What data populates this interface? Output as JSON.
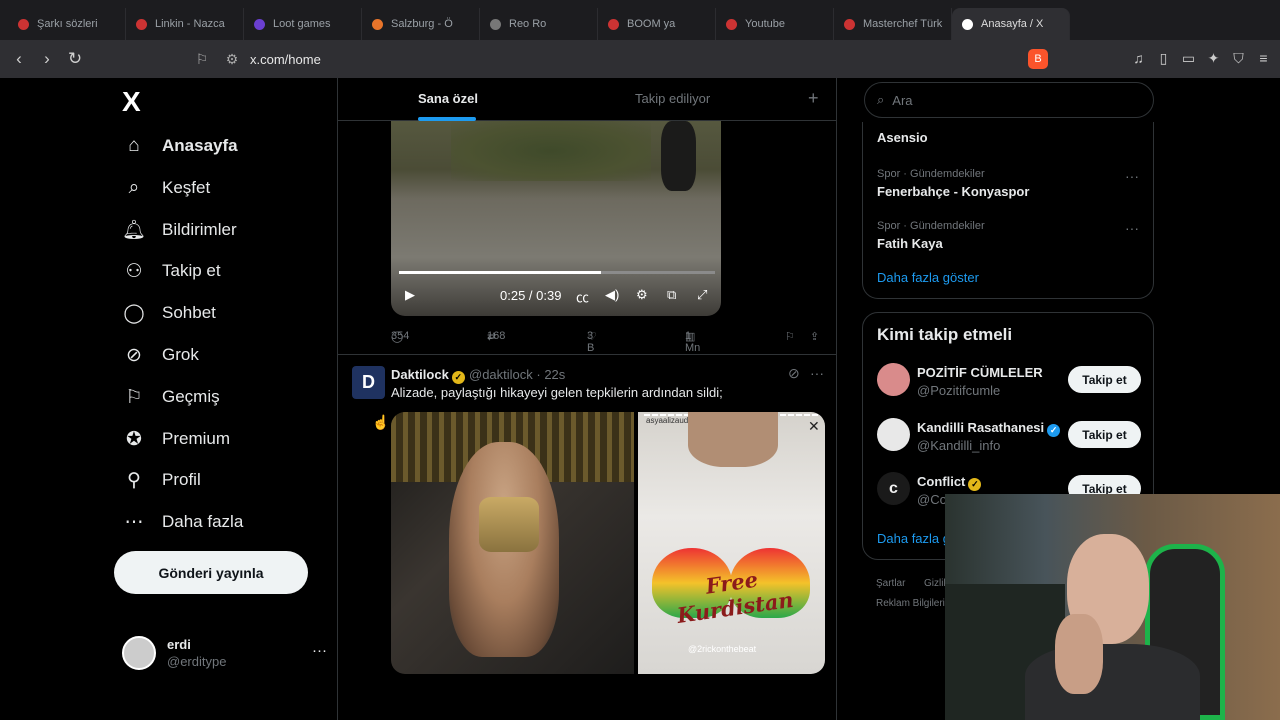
{
  "browser": {
    "tabs": [
      {
        "label": "Şarkı sözleri"
      },
      {
        "label": "Linkin - Nazca"
      },
      {
        "label": "Loot games"
      },
      {
        "label": "Salzburg - Ö"
      },
      {
        "label": "Reo Ro"
      },
      {
        "label": "BOOM ya"
      },
      {
        "label": "Youtube"
      },
      {
        "label": "Masterchef Türk"
      },
      {
        "label": "Anasayfa / X"
      }
    ],
    "url": "x.com/home"
  },
  "leftnav": {
    "logo": "X",
    "items": [
      {
        "label": "Anasayfa",
        "icon": "home-icon",
        "glyph": "⌂"
      },
      {
        "label": "Keşfet",
        "icon": "search-icon",
        "glyph": "⌕"
      },
      {
        "label": "Bildirimler",
        "icon": "bell-icon",
        "glyph": "🔔︎"
      },
      {
        "label": "Takip et",
        "icon": "add-person-icon",
        "glyph": "⚇"
      },
      {
        "label": "Sohbet",
        "icon": "chat-icon",
        "glyph": "◯"
      },
      {
        "label": "Grok",
        "icon": "grok-icon",
        "glyph": "⊘"
      },
      {
        "label": "Geçmiş",
        "icon": "bookmark-icon",
        "glyph": "⚐"
      },
      {
        "label": "Premium",
        "icon": "verified-icon",
        "glyph": "✪"
      },
      {
        "label": "Profil",
        "icon": "person-icon",
        "glyph": "⚲"
      },
      {
        "label": "Daha fazla",
        "icon": "more-circle-icon",
        "glyph": "⋯"
      }
    ],
    "post_button": "Gönderi yayınla",
    "account": {
      "name": "erdi",
      "handle": "@erditype"
    }
  },
  "center": {
    "tabs": [
      "Sana özel",
      "Takip ediliyor"
    ],
    "video": {
      "time": "0:25 / 0:39",
      "progress": 0.64
    },
    "video_actions": {
      "replies": "354",
      "reposts": "168",
      "likes": "3 B",
      "views": "1 Mn"
    },
    "tweet": {
      "avatar": "D",
      "name": "Daktilock",
      "handle": "@daktilock · 22s",
      "text": "Alizade, paylaştığı hikayeyi gelen tepkilerin ardından sildi;",
      "story_user": "asyaalizaude · 2d",
      "shirt_text": "Free Kurdistan",
      "shirt_tag": "@2rickonthebeat"
    }
  },
  "right": {
    "search_placeholder": "Ara",
    "trends": [
      {
        "meta": "",
        "title": "Asensio"
      },
      {
        "meta": "Spor · Gündemdekiler",
        "title": "Fenerbahçe - Konyaspor"
      },
      {
        "meta": "Spor · Gündemdekiler",
        "title": "Fatih Kaya"
      }
    ],
    "show_more": "Daha fazla göster",
    "who_to_follow": {
      "title": "Kimi takip etmeli",
      "accounts": [
        {
          "name": "POZİTİF CÜMLELER",
          "handle": "@Pozitifcumle",
          "color": "#d98b8b",
          "verified": ""
        },
        {
          "name": "Kandilli Rasathanesi",
          "handle": "@Kandilli_info",
          "color": "#e8e8e8",
          "verified": "blue"
        },
        {
          "name": "Conflict",
          "handle": "@Conflict",
          "color": "#1a1a1a",
          "verified": "gold"
        }
      ],
      "follow_label": "Takip et",
      "show_more": "Daha fazla göster"
    },
    "footer": [
      "Şartlar",
      "Gizlilik",
      "Reklam Bilgileri"
    ]
  },
  "colors": {
    "accent": "#1d9bf0",
    "background": "#000000",
    "border": "#2f3336"
  }
}
